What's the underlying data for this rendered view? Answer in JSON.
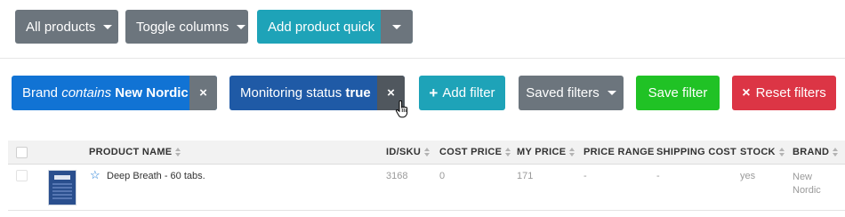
{
  "toolbar": {
    "all_products": "All products",
    "toggle_columns": "Toggle columns",
    "add_product_quick": "Add product quick"
  },
  "filters": {
    "brand_chip": {
      "field": "Brand",
      "operator": "contains",
      "value": "New Nordic",
      "remove": "×"
    },
    "monitoring_chip": {
      "field": "Monitoring status",
      "value": "true",
      "remove": "×"
    },
    "add_filter": "Add filter",
    "add_filter_icon": "+",
    "saved_filters": "Saved filters",
    "save_filter": "Save filter",
    "reset_filters": "Reset filters",
    "reset_icon": "×"
  },
  "table": {
    "columns": [
      "PRODUCT NAME",
      "ID/SKU",
      "COST PRICE",
      "MY PRICE",
      "PRICE RANGE",
      "SHIPPING COST",
      "STOCK",
      "BRAND"
    ],
    "rows": [
      {
        "product_name": "Deep Breath - 60 tabs.",
        "id_sku": "3168",
        "cost_price": "0",
        "my_price": "171",
        "price_range": "-",
        "shipping_cost": "-",
        "stock": "yes",
        "brand_line1": "New",
        "brand_line2": "Nordic"
      }
    ]
  },
  "colors": {
    "gray": "#6c757d",
    "teal": "#1ea3b8",
    "blue": "#1173d4",
    "navy": "#1f5aa6",
    "green": "#20c225",
    "red": "#dc3545"
  }
}
